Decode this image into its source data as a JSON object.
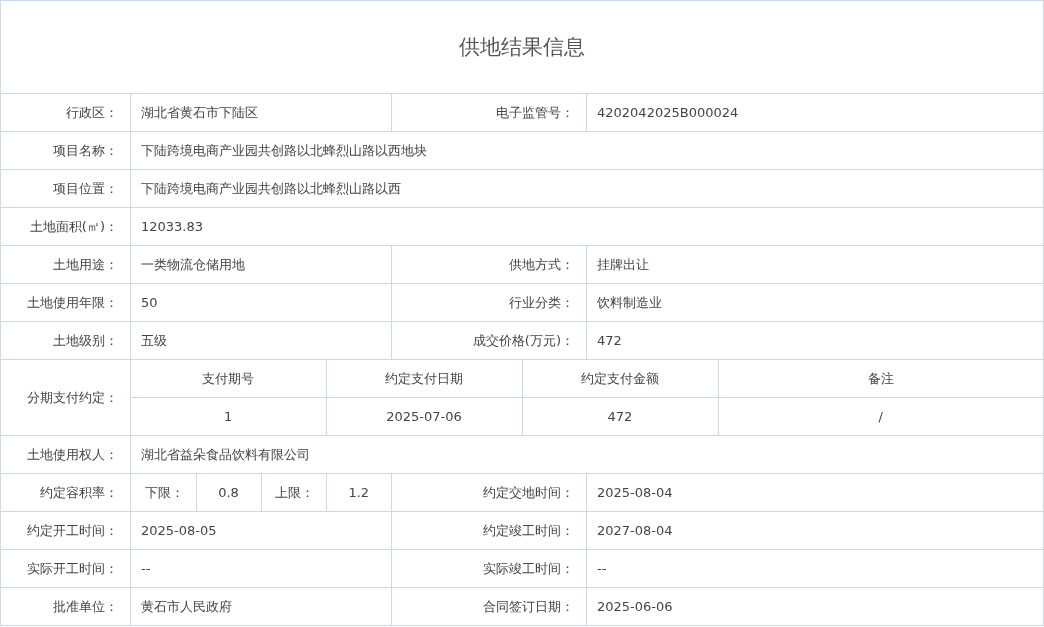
{
  "title": "供地结果信息",
  "rows": [
    {
      "kind": "pair",
      "label": "行政区：",
      "value": "湖北省黄石市下陆区",
      "label2": "电子监管号：",
      "value2": "4202042025B000024"
    },
    {
      "kind": "single",
      "label": "项目名称：",
      "value": "下陆跨境电商产业园共创路以北蜂烈山路以西地块"
    },
    {
      "kind": "single",
      "label": "项目位置：",
      "value": "下陆跨境电商产业园共创路以北蜂烈山路以西"
    },
    {
      "kind": "single",
      "label": "土地面积(㎡)：",
      "value": "12033.83"
    },
    {
      "kind": "pair",
      "label": "土地用途：",
      "value": "一类物流仓储用地",
      "label2": "供地方式：",
      "value2": "挂牌出让"
    },
    {
      "kind": "pair",
      "label": "土地使用年限：",
      "value": "50",
      "label2": "行业分类：",
      "value2": "饮料制造业"
    },
    {
      "kind": "pair",
      "label": "土地级别：",
      "value": "五级",
      "label2": "成交价格(万元)：",
      "value2": "472"
    },
    {
      "kind": "installments",
      "label": "分期支付约定：",
      "columns": [
        "支付期号",
        "约定支付日期",
        "约定支付金额",
        "备注"
      ],
      "rows": [
        [
          "1",
          "2025-07-06",
          "472",
          "/"
        ]
      ]
    },
    {
      "kind": "single",
      "label": "土地使用权人：",
      "value": "湖北省益朵食品饮料有限公司"
    },
    {
      "kind": "ratio",
      "label": "约定容积率：",
      "min_label": "下限：",
      "min": "0.8",
      "max_label": "上限：",
      "max": "1.2",
      "label2": "约定交地时间：",
      "value2": "2025-08-04"
    },
    {
      "kind": "pair",
      "label": "约定开工时间：",
      "value": "2025-08-05",
      "label2": "约定竣工时间：",
      "value2": "2027-08-04"
    },
    {
      "kind": "pair",
      "label": "实际开工时间：",
      "value": "--",
      "label2": "实际竣工时间：",
      "value2": "--"
    },
    {
      "kind": "pair",
      "label": "批准单位：",
      "value": "黄石市人民政府",
      "label2": "合同签订日期：",
      "value2": "2025-06-06"
    }
  ]
}
